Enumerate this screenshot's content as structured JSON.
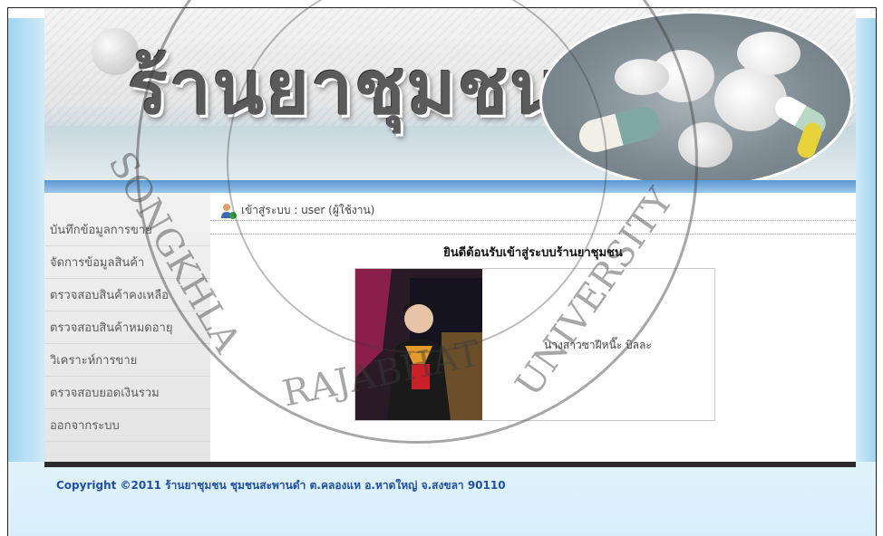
{
  "banner": {
    "title": "ร้านยาชุมชน"
  },
  "user_bar": {
    "login_text": "เข้าสู่ระบบ : user (ผู้ใช้งาน)"
  },
  "menu": {
    "items": [
      {
        "label": "บันทึกข้อมูลการขาย"
      },
      {
        "label": "จัดการข้อมูลสินค้า"
      },
      {
        "label": "ตรวจสอบสินค้าคงเหลือ"
      },
      {
        "label": "ตรวจสอบสินค้าหมดอายุ"
      },
      {
        "label": "วิเคราะห์การขาย"
      },
      {
        "label": "ตรวจสอบยอดเงินรวม"
      },
      {
        "label": "ออกจากระบบ"
      }
    ]
  },
  "main": {
    "welcome": "ยินดีต้อนรับเข้าสู่ระบบร้านยาชุมชน",
    "profile_name": "นางสาวซาฝีหนี๊ะ บิลละ"
  },
  "footer": {
    "copyright": "Copyright ©2011 ร้านยาชุมชน ชุมชนสะพานดำ ต.คลองแห อ.หาดใหญ่ จ.สงขลา 90110"
  },
  "watermark": {
    "text_left": "SONGKHLA",
    "text_bottom": "RAJABHAT",
    "text_right": "UNIVERSITY"
  }
}
